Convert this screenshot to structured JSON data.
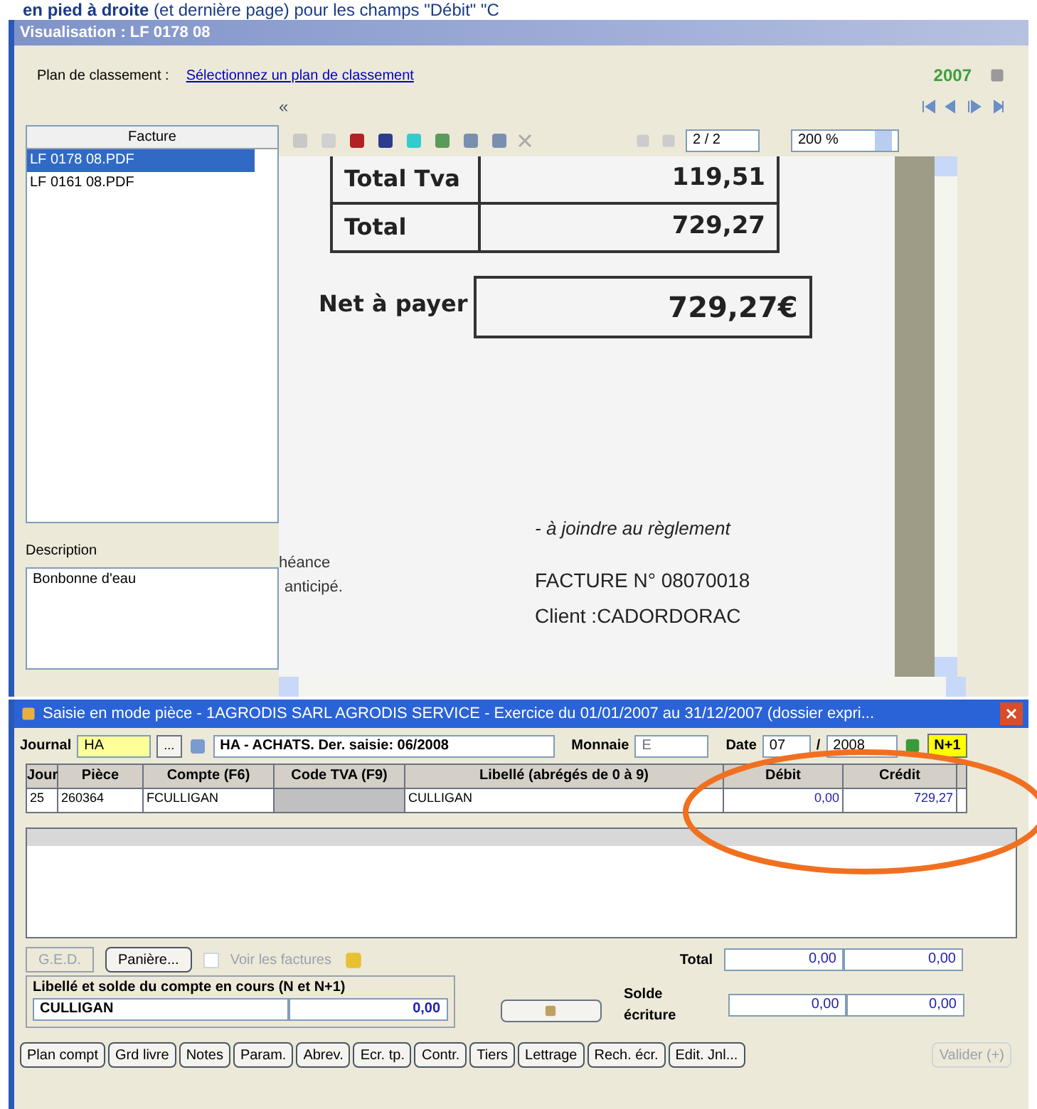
{
  "caption": {
    "text": "**en pied à droite** (et dernière page) pour les champs \"Débit\" \"C"
  },
  "viewer": {
    "title": "Visualisation : LF 0178 08",
    "plan_label": "Plan de classement :",
    "plan_link": "Sélectionnez un plan de classement",
    "year": "2007",
    "collapse": "«",
    "list": {
      "column": "Facture",
      "rows": [
        {
          "name": "LF 0178 08.PDF",
          "selected": true
        },
        {
          "name": "LF 0161 08.PDF",
          "selected": false
        }
      ]
    },
    "description_label": "Description",
    "description_value": "Bonbonne d'eau",
    "page": "2 / 2",
    "zoom": "200 %",
    "document": {
      "rows": [
        {
          "label": "Total Tva",
          "value": "119,51"
        },
        {
          "label": "Total",
          "value": "729,27"
        }
      ],
      "net_label": "Net à payer",
      "net_value": "729,27€",
      "side_1": "héance",
      "side_2": "anticipé.",
      "note": "- à joindre au règlement",
      "invoice": "FACTURE N°  08070018",
      "client": "Client :CADORDORAC"
    }
  },
  "entry": {
    "title": "Saisie en mode pièce - 1AGRODIS SARL AGRODIS SERVICE - Exercice du 01/01/2007 au 31/12/2007 (dossier expri...",
    "journal_label": "Journal",
    "journal_code": "HA",
    "browse": "...",
    "journal_name": "HA - ACHATS. Der. saisie: 06/2008",
    "currency_label": "Monnaie",
    "currency_value": "E",
    "date_label": "Date",
    "month": "07",
    "date_sep": "/",
    "date_year": "2008",
    "period": "N+1",
    "columns": [
      "Jour",
      "Pièce",
      "Compte (F6)",
      "Code TVA (F9)",
      "Libellé (abrégés de 0 à 9)",
      "Débit",
      "Crédit"
    ],
    "rows": [
      {
        "cells": [
          "25",
          "260364",
          "FCULLIGAN",
          "",
          "CULLIGAN",
          "0,00",
          "729,27"
        ]
      }
    ],
    "ged": {
      "label": "G.E.D.",
      "disabled": true
    },
    "basket": {
      "label": "Panière...",
      "disabled": false
    },
    "invoices_toggle": {
      "label": "Voir les factures",
      "checked": false,
      "disabled": true
    },
    "total_label": "Total",
    "total_debit": "0,00",
    "total_credit": "0,00",
    "balance_label": "Solde écriture",
    "balance_debit": "0,00",
    "balance_credit": "0,00",
    "account_label": "Libellé et solde du compte en cours (N et N+1)",
    "account_name": "CULLIGAN",
    "account_balance": "0,00",
    "buttons": [
      {
        "label": "Plan compt",
        "disabled": false
      },
      {
        "label": "Grd livre",
        "disabled": false
      },
      {
        "label": "Notes",
        "disabled": false
      },
      {
        "label": "Param.",
        "disabled": false
      },
      {
        "label": "Abrev.",
        "disabled": false
      },
      {
        "label": "Ecr. tp.",
        "disabled": false
      },
      {
        "label": "Contr.",
        "disabled": false
      },
      {
        "label": "Tiers",
        "disabled": false
      },
      {
        "label": "Lettrage",
        "disabled": false
      },
      {
        "label": "Rech. écr.",
        "disabled": false
      },
      {
        "label": "Edit. Jnl...",
        "disabled": false
      },
      {
        "label": "Valider (+)",
        "disabled": true
      }
    ]
  }
}
